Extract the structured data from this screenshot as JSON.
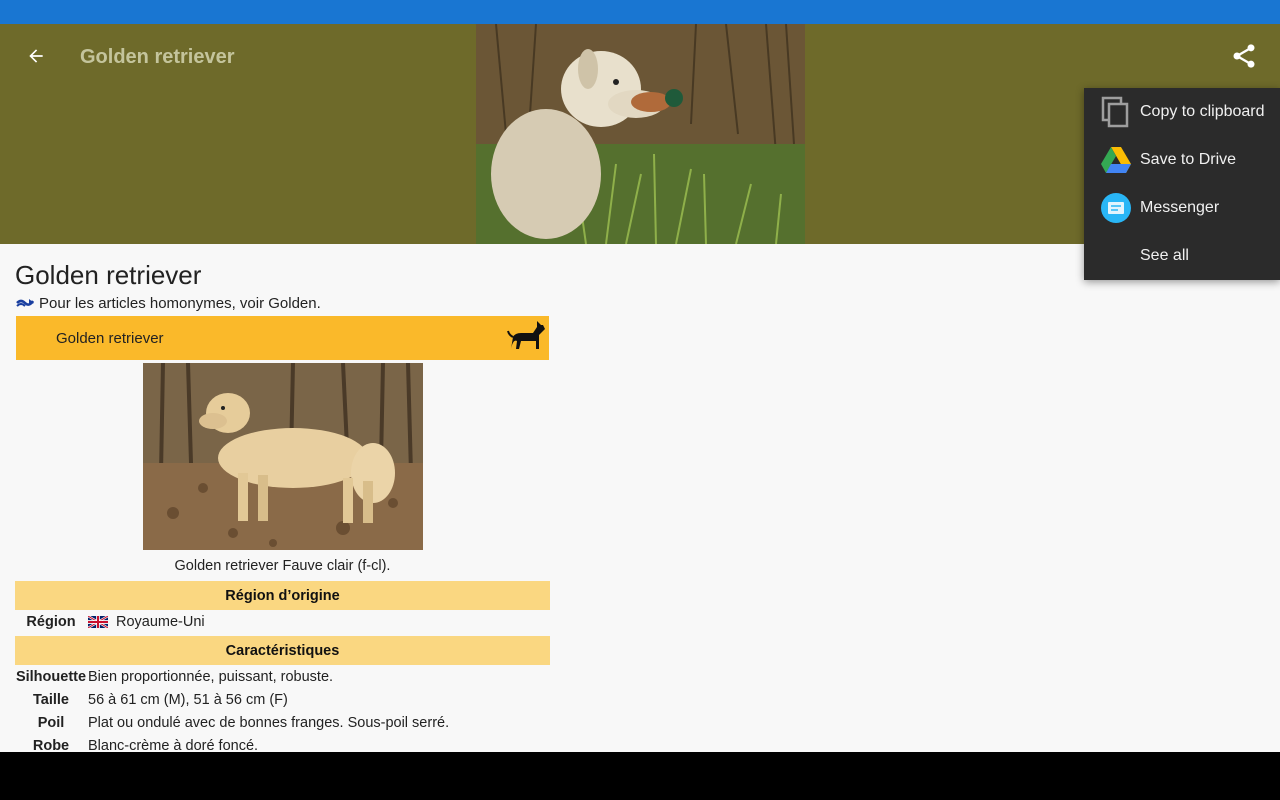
{
  "header": {
    "title": "Golden retriever"
  },
  "article": {
    "title": "Golden retriever",
    "hatnote_prefix": "Pour les articles homonymes, voir ",
    "hatnote_link": "Golden",
    "hatnote_suffix": "."
  },
  "infobox": {
    "header": "Golden retriever",
    "caption": "Golden retriever Fauve clair (f-cl).",
    "section_origin": "Région d’origine",
    "region_label": "Région",
    "region_value": "Royaume-Uni",
    "section_traits": "Caractéristiques",
    "rows": [
      {
        "label": "Silhouette",
        "value": "Bien proportionnée, puissant, robuste."
      },
      {
        "label": "Taille",
        "value": "56 à 61 cm (M), 51 à 56 cm (F)"
      },
      {
        "label": "Poil",
        "value": "Plat ou ondulé avec de bonnes franges. Sous-poil serré."
      },
      {
        "label": "Robe",
        "value": "Blanc-crème à doré foncé."
      }
    ]
  },
  "share_menu": {
    "items": [
      {
        "label": "Copy to clipboard",
        "icon": "copy-icon"
      },
      {
        "label": "Save to Drive",
        "icon": "drive-icon"
      },
      {
        "label": "Messenger",
        "icon": "messenger-icon"
      },
      {
        "label": "See all",
        "icon": ""
      }
    ]
  },
  "colors": {
    "status_bar": "#1976d2",
    "header_bg": "#6e6a2a",
    "infobox_header": "#fab92a",
    "section_bg": "#fad781",
    "menu_bg": "#2b2b2b"
  }
}
